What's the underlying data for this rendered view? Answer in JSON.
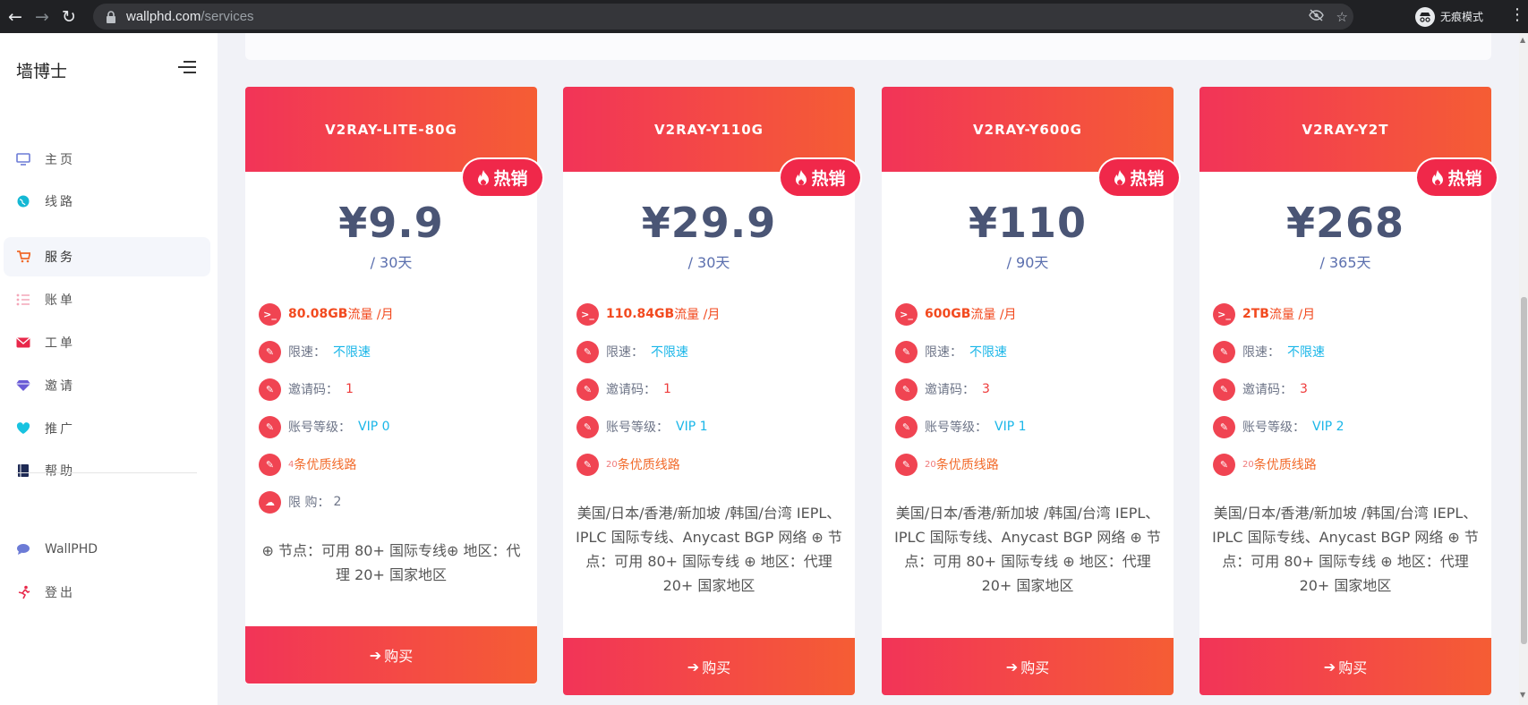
{
  "browser": {
    "url_host": "wallphd.com",
    "url_path": "/services",
    "incognito_label": "无痕模式"
  },
  "sidebar": {
    "brand": "墙博士",
    "items": [
      {
        "label": "主页",
        "icon": "monitor-icon",
        "color": "#6c7bd6"
      },
      {
        "label": "线路",
        "icon": "globe-icon",
        "color": "#14b8d4"
      },
      {
        "label": "服务",
        "icon": "cart-icon",
        "color": "#f06a2a"
      },
      {
        "label": "账单",
        "icon": "list-icon",
        "color": "#f4a6b8"
      },
      {
        "label": "工单",
        "icon": "mail-icon",
        "color": "#e8284a"
      },
      {
        "label": "邀请",
        "icon": "diamond-icon",
        "color": "#6a5bd6"
      },
      {
        "label": "推广",
        "icon": "heart-icon",
        "color": "#18c3e0"
      },
      {
        "label": "帮助",
        "icon": "book-icon",
        "color": "#1e2a55"
      }
    ],
    "extra": [
      {
        "label": "WallPHD",
        "icon": "chat-icon",
        "color": "#6c7bd6"
      },
      {
        "label": "登出",
        "icon": "logout-icon",
        "color": "#e8284a"
      }
    ]
  },
  "plans": [
    {
      "name": "V2RAY-LITE-80G",
      "hot_label": "热销",
      "price": "¥9.9",
      "period": "/ 30天",
      "traffic_value": "80.08GB",
      "traffic_unit": "流量 /月",
      "speed_label": "限速：",
      "speed_value": "不限速",
      "invite_label": "邀请码：",
      "invite_value": "1",
      "vip_label": "账号等级：",
      "vip_value": "VIP 0",
      "lines_count": "4",
      "lines_label": "条优质线路",
      "limit_label": "限 购：",
      "limit_value": "2",
      "description": "⊕ 节点：可用 80+ 国际专线⊕ 地区：代理 20+ 国家地区",
      "buy_label": "购买"
    },
    {
      "name": "V2RAY-Y110G",
      "hot_label": "热销",
      "price": "¥29.9",
      "period": "/ 30天",
      "traffic_value": "110.84GB",
      "traffic_unit": "流量 /月",
      "speed_label": "限速：",
      "speed_value": "不限速",
      "invite_label": "邀请码：",
      "invite_value": "1",
      "vip_label": "账号等级：",
      "vip_value": "VIP 1",
      "lines_count": "20",
      "lines_label": "条优质线路",
      "description": "美国/日本/香港/新加坡 /韩国/台湾 IEPL、IPLC 国际专线、Anycast BGP 网络 ⊕ 节点：可用 80+ 国际专线 ⊕ 地区：代理 20+ 国家地区",
      "buy_label": "购买"
    },
    {
      "name": "V2RAY-Y600G",
      "hot_label": "热销",
      "price": "¥110",
      "period": "/ 90天",
      "traffic_value": "600GB",
      "traffic_unit": "流量 /月",
      "speed_label": "限速：",
      "speed_value": "不限速",
      "invite_label": "邀请码：",
      "invite_value": "3",
      "vip_label": "账号等级：",
      "vip_value": "VIP 1",
      "lines_count": "20",
      "lines_label": "条优质线路",
      "description": "美国/日本/香港/新加坡 /韩国/台湾 IEPL、IPLC 国际专线、Anycast BGP 网络 ⊕ 节点：可用 80+ 国际专线 ⊕ 地区：代理 20+ 国家地区",
      "buy_label": "购买"
    },
    {
      "name": "V2RAY-Y2T",
      "hot_label": "热销",
      "price": "¥268",
      "period": "/ 365天",
      "traffic_value": "2TB",
      "traffic_unit": "流量 /月",
      "speed_label": "限速：",
      "speed_value": "不限速",
      "invite_label": "邀请码：",
      "invite_value": "3",
      "vip_label": "账号等级：",
      "vip_value": "VIP 2",
      "lines_count": "20",
      "lines_label": "条优质线路",
      "description": "美国/日本/香港/新加坡 /韩国/台湾 IEPL、IPLC 国际专线、Anycast BGP 网络 ⊕ 节点：可用 80+ 国际专线 ⊕ 地区：代理 20+ 国家地区",
      "buy_label": "购买"
    }
  ],
  "colors": {
    "accent_start": "#f23458",
    "accent_end": "#f55d34",
    "price_text": "#4a5575",
    "link_blue": "#1ab6e8"
  }
}
